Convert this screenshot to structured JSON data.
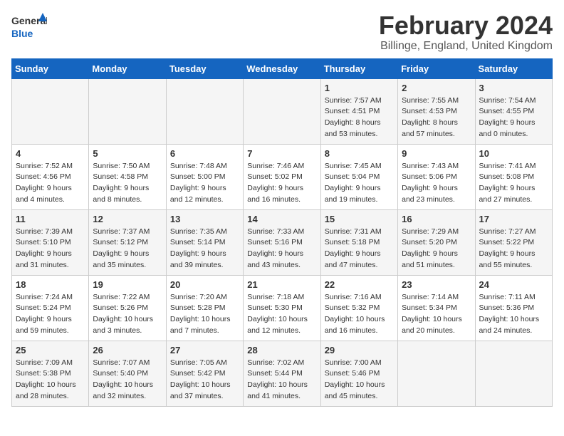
{
  "logo": {
    "text_general": "General",
    "text_blue": "Blue"
  },
  "title": "February 2024",
  "subtitle": "Billinge, England, United Kingdom",
  "weekdays": [
    "Sunday",
    "Monday",
    "Tuesday",
    "Wednesday",
    "Thursday",
    "Friday",
    "Saturday"
  ],
  "weeks": [
    [
      {
        "day": "",
        "info": ""
      },
      {
        "day": "",
        "info": ""
      },
      {
        "day": "",
        "info": ""
      },
      {
        "day": "",
        "info": ""
      },
      {
        "day": "1",
        "sunrise": "7:57 AM",
        "sunset": "4:51 PM",
        "daylight": "8 hours and 53 minutes."
      },
      {
        "day": "2",
        "sunrise": "7:55 AM",
        "sunset": "4:53 PM",
        "daylight": "8 hours and 57 minutes."
      },
      {
        "day": "3",
        "sunrise": "7:54 AM",
        "sunset": "4:55 PM",
        "daylight": "9 hours and 0 minutes."
      }
    ],
    [
      {
        "day": "4",
        "sunrise": "7:52 AM",
        "sunset": "4:56 PM",
        "daylight": "9 hours and 4 minutes."
      },
      {
        "day": "5",
        "sunrise": "7:50 AM",
        "sunset": "4:58 PM",
        "daylight": "9 hours and 8 minutes."
      },
      {
        "day": "6",
        "sunrise": "7:48 AM",
        "sunset": "5:00 PM",
        "daylight": "9 hours and 12 minutes."
      },
      {
        "day": "7",
        "sunrise": "7:46 AM",
        "sunset": "5:02 PM",
        "daylight": "9 hours and 16 minutes."
      },
      {
        "day": "8",
        "sunrise": "7:45 AM",
        "sunset": "5:04 PM",
        "daylight": "9 hours and 19 minutes."
      },
      {
        "day": "9",
        "sunrise": "7:43 AM",
        "sunset": "5:06 PM",
        "daylight": "9 hours and 23 minutes."
      },
      {
        "day": "10",
        "sunrise": "7:41 AM",
        "sunset": "5:08 PM",
        "daylight": "9 hours and 27 minutes."
      }
    ],
    [
      {
        "day": "11",
        "sunrise": "7:39 AM",
        "sunset": "5:10 PM",
        "daylight": "9 hours and 31 minutes."
      },
      {
        "day": "12",
        "sunrise": "7:37 AM",
        "sunset": "5:12 PM",
        "daylight": "9 hours and 35 minutes."
      },
      {
        "day": "13",
        "sunrise": "7:35 AM",
        "sunset": "5:14 PM",
        "daylight": "9 hours and 39 minutes."
      },
      {
        "day": "14",
        "sunrise": "7:33 AM",
        "sunset": "5:16 PM",
        "daylight": "9 hours and 43 minutes."
      },
      {
        "day": "15",
        "sunrise": "7:31 AM",
        "sunset": "5:18 PM",
        "daylight": "9 hours and 47 minutes."
      },
      {
        "day": "16",
        "sunrise": "7:29 AM",
        "sunset": "5:20 PM",
        "daylight": "9 hours and 51 minutes."
      },
      {
        "day": "17",
        "sunrise": "7:27 AM",
        "sunset": "5:22 PM",
        "daylight": "9 hours and 55 minutes."
      }
    ],
    [
      {
        "day": "18",
        "sunrise": "7:24 AM",
        "sunset": "5:24 PM",
        "daylight": "9 hours and 59 minutes."
      },
      {
        "day": "19",
        "sunrise": "7:22 AM",
        "sunset": "5:26 PM",
        "daylight": "10 hours and 3 minutes."
      },
      {
        "day": "20",
        "sunrise": "7:20 AM",
        "sunset": "5:28 PM",
        "daylight": "10 hours and 7 minutes."
      },
      {
        "day": "21",
        "sunrise": "7:18 AM",
        "sunset": "5:30 PM",
        "daylight": "10 hours and 12 minutes."
      },
      {
        "day": "22",
        "sunrise": "7:16 AM",
        "sunset": "5:32 PM",
        "daylight": "10 hours and 16 minutes."
      },
      {
        "day": "23",
        "sunrise": "7:14 AM",
        "sunset": "5:34 PM",
        "daylight": "10 hours and 20 minutes."
      },
      {
        "day": "24",
        "sunrise": "7:11 AM",
        "sunset": "5:36 PM",
        "daylight": "10 hours and 24 minutes."
      }
    ],
    [
      {
        "day": "25",
        "sunrise": "7:09 AM",
        "sunset": "5:38 PM",
        "daylight": "10 hours and 28 minutes."
      },
      {
        "day": "26",
        "sunrise": "7:07 AM",
        "sunset": "5:40 PM",
        "daylight": "10 hours and 32 minutes."
      },
      {
        "day": "27",
        "sunrise": "7:05 AM",
        "sunset": "5:42 PM",
        "daylight": "10 hours and 37 minutes."
      },
      {
        "day": "28",
        "sunrise": "7:02 AM",
        "sunset": "5:44 PM",
        "daylight": "10 hours and 41 minutes."
      },
      {
        "day": "29",
        "sunrise": "7:00 AM",
        "sunset": "5:46 PM",
        "daylight": "10 hours and 45 minutes."
      },
      {
        "day": "",
        "info": ""
      },
      {
        "day": "",
        "info": ""
      }
    ]
  ]
}
